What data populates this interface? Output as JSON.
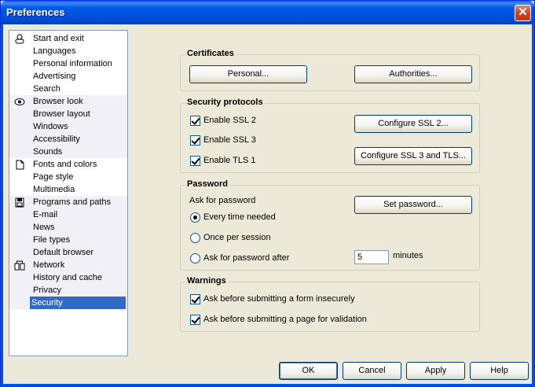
{
  "window": {
    "title": "Preferences",
    "close_symbol": "✕"
  },
  "sidebar": {
    "groups": [
      {
        "icon": "person-icon",
        "items": [
          "Start and exit",
          "Languages",
          "Personal information",
          "Advertising",
          "Search"
        ]
      },
      {
        "icon": "eye-icon",
        "items": [
          "Browser look",
          "Browser layout",
          "Windows",
          "Accessibility",
          "Sounds"
        ]
      },
      {
        "icon": "page-icon",
        "items": [
          "Fonts and colors",
          "Page style",
          "Multimedia"
        ]
      },
      {
        "icon": "disk-icon",
        "items": [
          "Programs and paths",
          "E-mail",
          "News",
          "File types",
          "Default browser"
        ]
      },
      {
        "icon": "network-icon",
        "items": [
          "Network",
          "History and cache",
          "Privacy",
          "Security"
        ]
      }
    ],
    "selected": "Security"
  },
  "certificates": {
    "legend": "Certificates",
    "personal_button": "Personal...",
    "authorities_button": "Authorities..."
  },
  "protocols": {
    "legend": "Security protocols",
    "ssl2_label": "Enable SSL 2",
    "ssl2_checked": true,
    "ssl3_label": "Enable SSL 3",
    "ssl3_checked": true,
    "tls1_label": "Enable TLS 1",
    "tls1_checked": true,
    "configure_ssl2_button": "Configure SSL 2...",
    "configure_ssl3_button": "Configure SSL 3 and TLS..."
  },
  "password": {
    "legend": "Password",
    "ask_label": "Ask for password",
    "set_password_button": "Set password...",
    "options": [
      "Every time needed",
      "Once per session",
      "Ask for password after"
    ],
    "selected_option": "Every time needed",
    "minutes_value": "5",
    "minutes_label": "minutes"
  },
  "warnings": {
    "legend": "Warnings",
    "form_insecure_label": "Ask before submitting a form insecurely",
    "form_insecure_checked": true,
    "page_validation_label": "Ask before submitting a page for validation",
    "page_validation_checked": true
  },
  "footer": {
    "ok": "OK",
    "cancel": "Cancel",
    "apply": "Apply",
    "help": "Help"
  }
}
